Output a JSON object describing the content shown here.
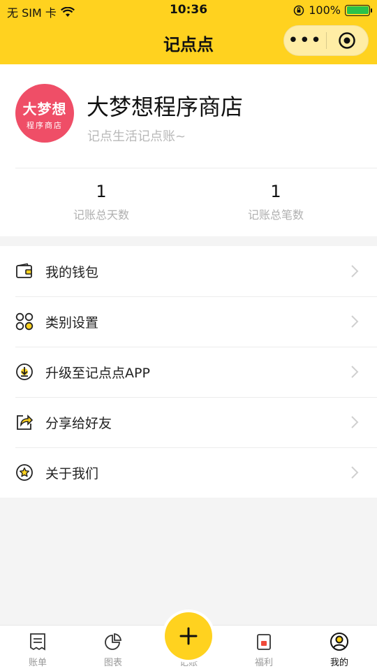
{
  "status_bar": {
    "carrier": "无 SIM 卡",
    "time": "10:36",
    "battery": "100%"
  },
  "nav": {
    "title": "记点点",
    "more_label": "•••"
  },
  "profile": {
    "avatar_line1": "大梦想",
    "avatar_line2": "程序商店",
    "name": "大梦想程序商店",
    "subtitle": "记点生活记点账~",
    "stats": [
      {
        "value": "1",
        "label": "记账总天数"
      },
      {
        "value": "1",
        "label": "记账总笔数"
      }
    ]
  },
  "menu": {
    "items": [
      {
        "label": "我的钱包",
        "icon": "wallet-icon"
      },
      {
        "label": "类别设置",
        "icon": "category-icon"
      },
      {
        "label": "升级至记点点APP",
        "icon": "download-icon"
      },
      {
        "label": "分享给好友",
        "icon": "share-icon"
      },
      {
        "label": "关于我们",
        "icon": "star-icon"
      }
    ]
  },
  "tabbar": {
    "items": [
      {
        "label": "账单",
        "icon": "bill-icon"
      },
      {
        "label": "图表",
        "icon": "chart-icon"
      },
      {
        "label": "记账",
        "icon": "plus-icon"
      },
      {
        "label": "福利",
        "icon": "gift-icon"
      },
      {
        "label": "我的",
        "icon": "user-icon"
      }
    ]
  },
  "colors": {
    "brand": "#ffd21f",
    "avatar": "#ef4e67"
  }
}
